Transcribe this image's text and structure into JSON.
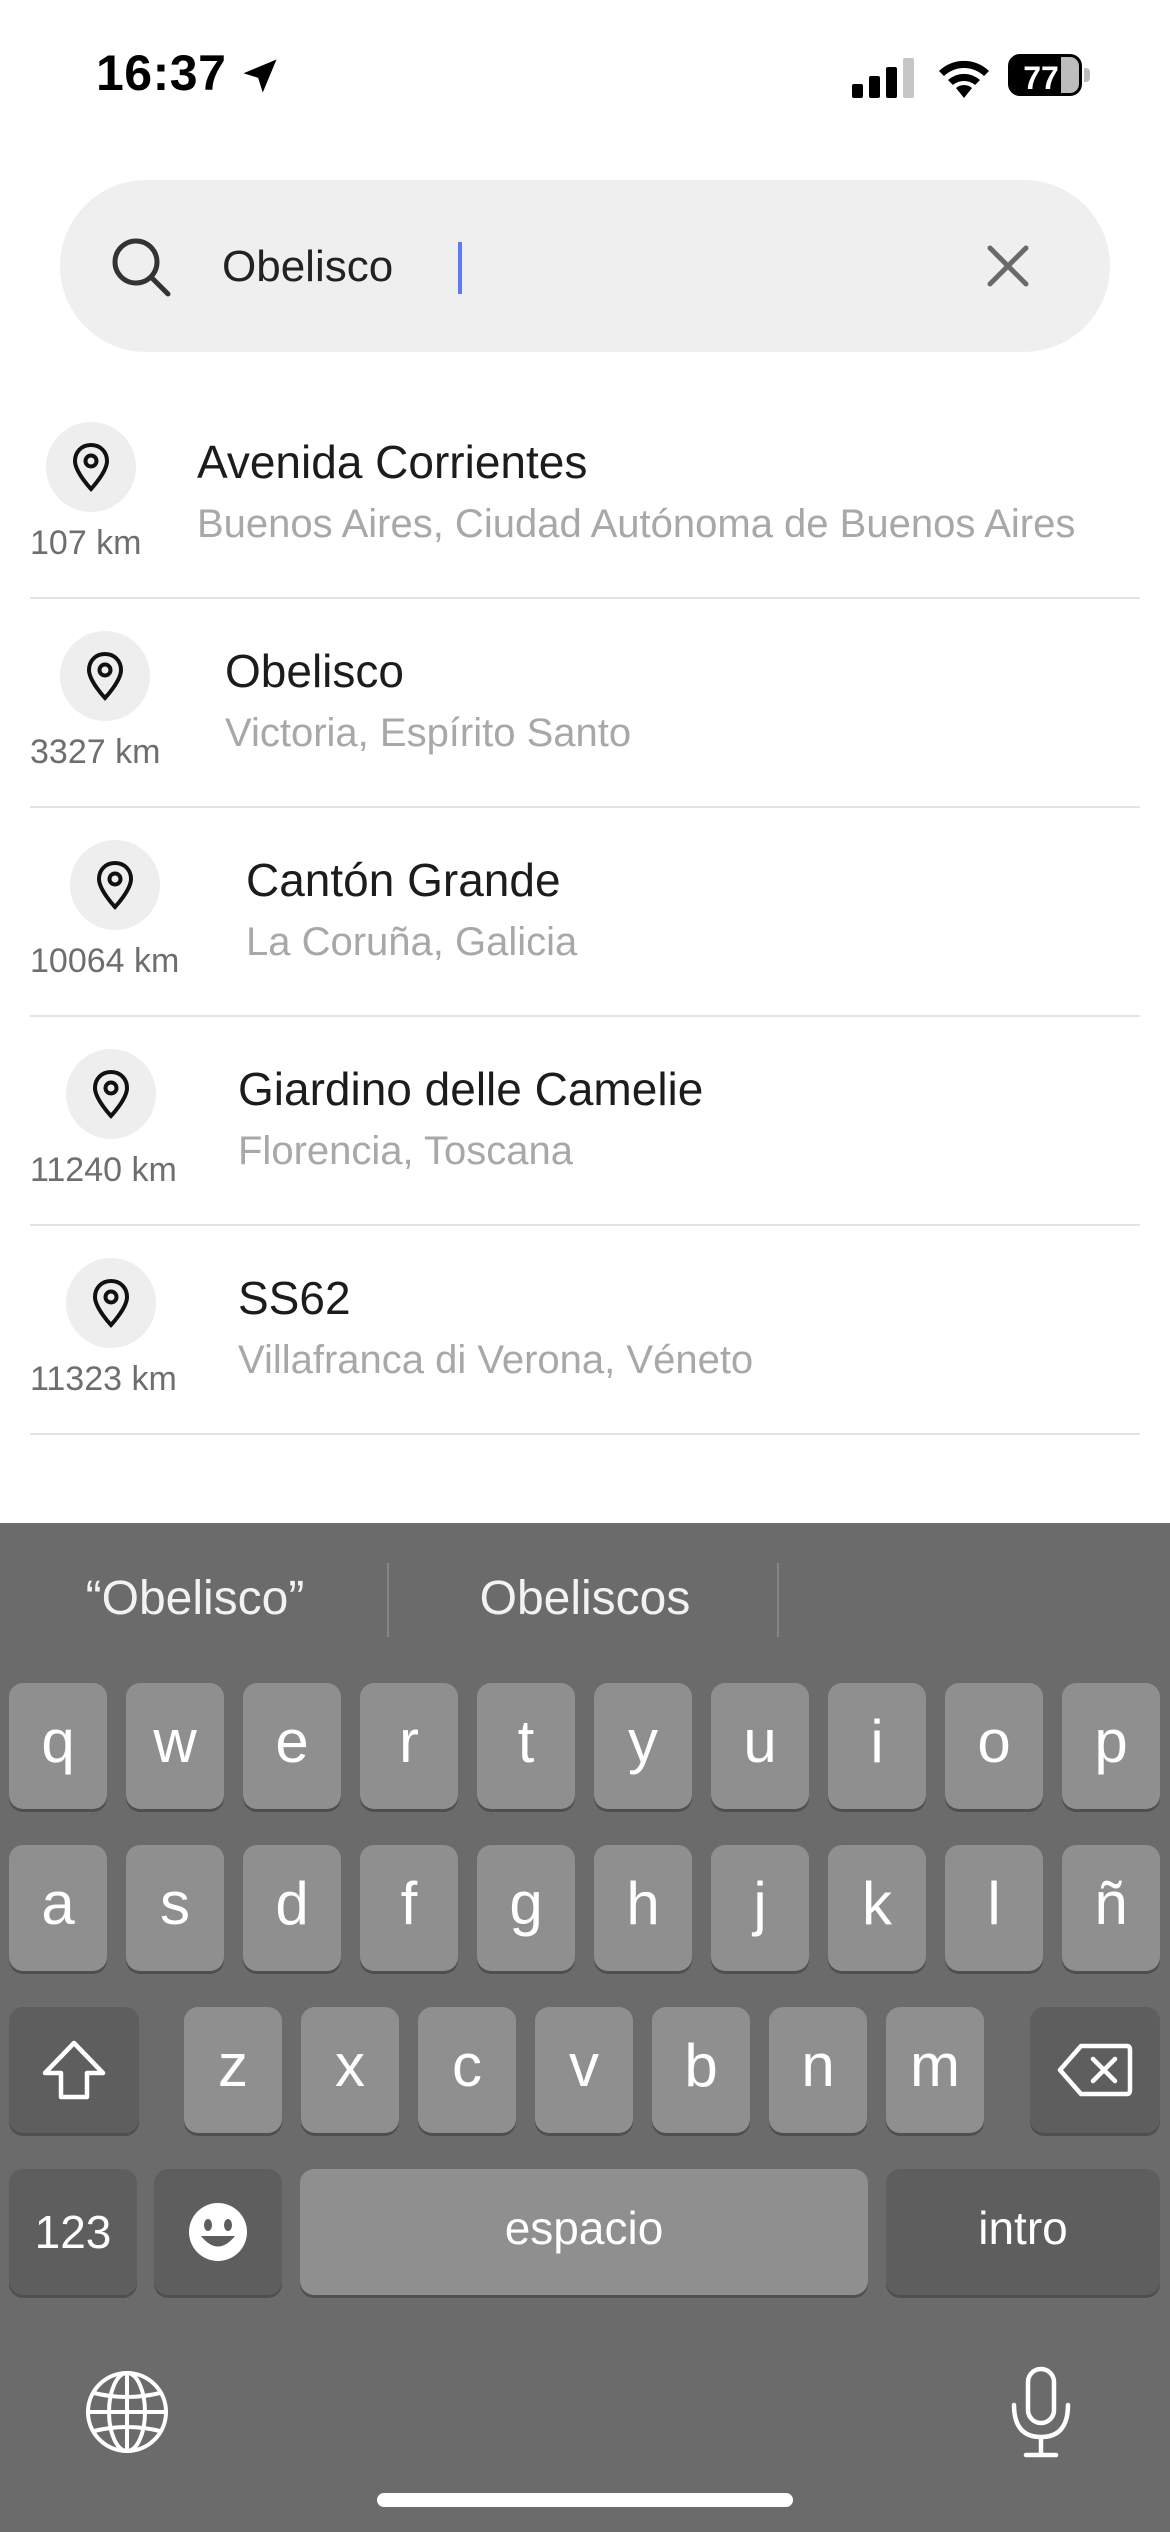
{
  "status_bar": {
    "time": "16:37",
    "battery": "77",
    "location_icon": "location-arrow-icon",
    "signal_icon": "cellular-signal-icon",
    "wifi_icon": "wifi-icon"
  },
  "search": {
    "value": "Obelisco",
    "search_icon": "search-icon",
    "clear_icon": "close-icon"
  },
  "results": [
    {
      "title": "Avenida Corrientes",
      "subtitle": "Buenos Aires, Ciudad Autónoma de Buenos Aires",
      "distance": "107 km"
    },
    {
      "title": "Obelisco",
      "subtitle": "Victoria, Espírito Santo",
      "distance": "3327 km"
    },
    {
      "title": "Cantón Grande",
      "subtitle": "La Coruña, Galicia",
      "distance": "10064 km"
    },
    {
      "title": "Giardino delle Camelie",
      "subtitle": "Florencia, Toscana",
      "distance": "11240 km"
    },
    {
      "title": "SS62",
      "subtitle": "Villafranca di Verona, Véneto",
      "distance": "11323 km"
    }
  ],
  "keyboard": {
    "suggestions": [
      "“Obelisco”",
      "Obeliscos"
    ],
    "row1": [
      "q",
      "w",
      "e",
      "r",
      "t",
      "y",
      "u",
      "i",
      "o",
      "p"
    ],
    "row2": [
      "a",
      "s",
      "d",
      "f",
      "g",
      "h",
      "j",
      "k",
      "l",
      "ñ"
    ],
    "row3": [
      "z",
      "x",
      "c",
      "v",
      "b",
      "n",
      "m"
    ],
    "numbers_label": "123",
    "space_label": "espacio",
    "return_label": "intro"
  },
  "colors": {
    "accent_caret": "#5b7cf6",
    "keyboard_bg": "#6b6b6b",
    "key_bg": "#8f8f8f"
  }
}
